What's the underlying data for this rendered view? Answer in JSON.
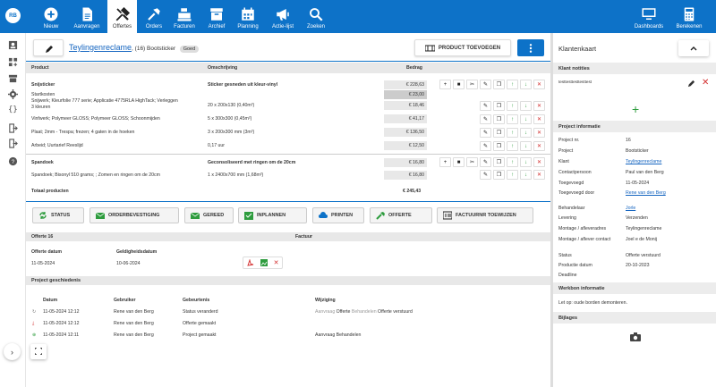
{
  "user": {
    "initials": "RB"
  },
  "nav": {
    "items": [
      {
        "label": "Nieuw",
        "icon": "plus-circle-icon"
      },
      {
        "label": "Aanvragen",
        "icon": "document-icon"
      },
      {
        "label": "Offertes",
        "icon": "tools-icon"
      },
      {
        "label": "Orders",
        "icon": "hammer-icon"
      },
      {
        "label": "Facturen",
        "icon": "cash-register-icon"
      },
      {
        "label": "Archief",
        "icon": "archive-icon"
      },
      {
        "label": "Planning",
        "icon": "calendar-icon"
      },
      {
        "label": "Actie-lijst",
        "icon": "megaphone-icon"
      },
      {
        "label": "Zoeken",
        "icon": "search-icon"
      }
    ],
    "right": [
      {
        "label": "Dashboards",
        "icon": "monitor-icon"
      },
      {
        "label": "Berekenen",
        "icon": "calculator-icon"
      }
    ]
  },
  "header": {
    "link": "Teylingenreclame",
    "rest": ", (16) Bootsticker",
    "badge": "Goed",
    "add_product": "PRODUCT TOEVOEGEN"
  },
  "table": {
    "headers": {
      "product": "Product",
      "description": "Omschrijving",
      "amount": "Bedrag"
    },
    "group1": {
      "title": "Snijsticker",
      "title_desc": "Sticker gesneden uit kleur-vinyl",
      "total": "€ 228,63",
      "lines": [
        {
          "p": "Startkosten",
          "d": "",
          "a": "€ 23,00"
        },
        {
          "p": "Snijwerk; Kleurfolie 777 serie; Applicatie 4775RLA HighTack; Verleggen",
          "p2": "3 kleuren",
          "d": "20 x 200x130 (0,40m²)",
          "a": "€ 18,46"
        },
        {
          "p": "Vinfwerk; Polymeer GLOSS; Polymeer GLOSS; Schoonmijden",
          "d": "5 x 300x300 (0,45m²)",
          "a": "€ 41,17"
        },
        {
          "p": "Plaat; 2mm - Trespa; frezen; 4 gaten in de hoeken",
          "d": "3 x 200x300 mm (3m²)",
          "a": "€ 136,50"
        },
        {
          "p": "Arbeid; Uurtarief Reeslijd",
          "d": "0,17 uur",
          "a": "€ 12,50"
        }
      ]
    },
    "group2": {
      "title": "Spandoek",
      "title_desc": "Geconsoliseerd met ringen om de 20cm",
      "total": "€ 16,80",
      "lines": [
        {
          "p": "Spandoek; Bisonyl 510 grams; ; Zomen en ringen om de 20cm",
          "d": "1 x 2400x700 mm (1,68m²)",
          "a": "€ 16,80"
        }
      ]
    },
    "total_label": "Totaal producten",
    "total_value": "€ 245,43"
  },
  "actions": {
    "status": "STATUS",
    "order": "ORDERBEVESTIGING",
    "ready": "GEREED",
    "plan": "INPLANNEN",
    "print": "PRINTEN",
    "quote": "OFFERTE",
    "invoice": "FACTUURNR TOEWIJZEN"
  },
  "quote": {
    "title": "Offerte 16",
    "invoice_head": "Factuur",
    "date_label": "Offerte datum",
    "date": "11-05-2024",
    "valid_label": "Geldigheidsdatum",
    "valid": "10-06-2024"
  },
  "history": {
    "title": "Project geschiedenis",
    "cols": {
      "date": "Datum",
      "user": "Gebruiker",
      "event": "Gebeurtenis",
      "change": "Wijziging"
    },
    "rows": [
      {
        "date": "11-05-2024 12:12",
        "user": "Rene van den Berg",
        "event": "Status veranderd",
        "c1": "Aanvraag",
        "c2": "Offerte",
        "c3": "Behandelen",
        "c4": "Offerte verstuurd"
      },
      {
        "date": "11-05-2024 12:12",
        "user": "Rene van den Berg",
        "event": "Offerte gemaakt",
        "c1": "",
        "c2": "",
        "c3": "",
        "c4": ""
      },
      {
        "date": "11-05-2024 12:11",
        "user": "Rene van den Berg",
        "event": "Project gemaakt",
        "c1": "",
        "c2": "Aanvraag",
        "c3": "Behandelen",
        "c4": ""
      }
    ]
  },
  "right": {
    "title": "Klantenkaart",
    "notes_title": "Klant notities",
    "note": "testtesttesttesttest",
    "project_title": "Project informatie",
    "info": [
      {
        "k": "Project nr.",
        "v": "16"
      },
      {
        "k": "Project",
        "v": "Bootsticker"
      },
      {
        "k": "Klant",
        "v": "Teylingenreclame",
        "link": true
      },
      {
        "k": "Contactpersoon",
        "v": "Paul van den Berg"
      },
      {
        "k": "Toegevoegd",
        "v": "11-05-2024"
      },
      {
        "k": "Toegevoegd door",
        "v": "Rene van den Berg",
        "link": true
      },
      {
        "k": "Behandelaar",
        "v": "Jorle",
        "link": true
      },
      {
        "k": "Levering",
        "v": "Verzenden"
      },
      {
        "k": "Montage / afleveradres",
        "v": "Teylingenreclame"
      },
      {
        "k": "Montage / aflever contact",
        "v": "Joel e de Monij"
      },
      {
        "k": "Status",
        "v": "Offerte verstuurd"
      },
      {
        "k": "Productie datum",
        "v": "20-10-2023"
      },
      {
        "k": "Deadline",
        "v": ""
      }
    ],
    "werkbon_title": "Werkbon informatie",
    "werkbon_text": "Let op: oude borden demonteren.",
    "bijlages_title": "Bijlages"
  }
}
